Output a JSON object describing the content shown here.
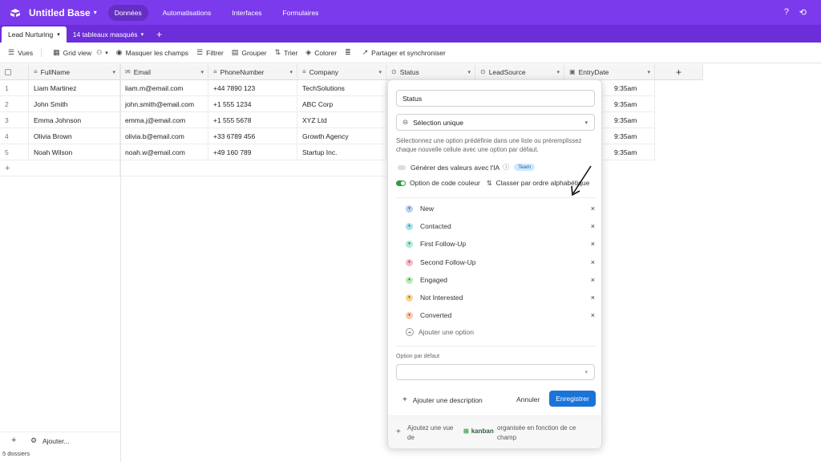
{
  "app": {
    "base_title": "Untitled Base",
    "nav": [
      "Données",
      "Automatisations",
      "Interfaces",
      "Formulaires"
    ],
    "active_nav": "Données",
    "colors": {
      "brand": "#7c3aed",
      "tabbar": "#6b2ed8",
      "primary": "#1a73d9"
    }
  },
  "tabs": {
    "active": "Lead Nurturing",
    "hidden": "14 tableaux masqués"
  },
  "toolbar": {
    "views": "Vues",
    "grid_view": "Grid view",
    "hide_fields": "Masquer les champs",
    "filter": "Filtrer",
    "group": "Grouper",
    "sort": "Trier",
    "color": "Colorer",
    "share": "Partager et synchroniser"
  },
  "table": {
    "headers": [
      "FullName",
      "Email",
      "PhoneNumber",
      "Company",
      "Status",
      "LeadSource",
      "EntryDate"
    ],
    "rows": [
      {
        "n": "1",
        "name": "Liam Martinez",
        "email": "liam.m@email.com",
        "phone": "+44 7890 123",
        "company": "TechSolutions",
        "time": "9:35am"
      },
      {
        "n": "2",
        "name": "John Smith",
        "email": "john.smith@email.com",
        "phone": "+1 555 1234",
        "company": "ABC Corp",
        "time": "9:35am"
      },
      {
        "n": "3",
        "name": "Emma Johnson",
        "email": "emma.j@email.com",
        "phone": "+1 555 5678",
        "company": "XYZ Ltd",
        "time": "9:35am"
      },
      {
        "n": "4",
        "name": "Olivia Brown",
        "email": "olivia.b@email.com",
        "phone": "+33 6789 456",
        "company": "Growth Agency",
        "time": "9:35am"
      },
      {
        "n": "5",
        "name": "Noah Wilson",
        "email": "noah.w@email.com",
        "phone": "+49 160 789",
        "company": "Startup Inc.",
        "time": "9:35am"
      }
    ],
    "add_row": "+"
  },
  "footer": {
    "add_label": "Ajouter...",
    "count": "5 dossiers"
  },
  "modal": {
    "field_name": "Status",
    "field_type": "Sélection unique",
    "description": "Sélectionnez une option prédéfinie dans une liste ou préremplissez chaque nouvelle cellule avec une option par défaut.",
    "ai_label": "Générer des valeurs avec l'IA",
    "ai_badge": "Team",
    "color_code": "Option de code couleur",
    "sort_alpha": "Classer par ordre alphabétique",
    "options": [
      {
        "label": "New",
        "color": "#b9cdf5"
      },
      {
        "label": "Contacted",
        "color": "#a8e0f0"
      },
      {
        "label": "First Follow-Up",
        "color": "#a6ecd9"
      },
      {
        "label": "Second Follow-Up",
        "color": "#f8b8c4"
      },
      {
        "label": "Engaged",
        "color": "#b9ecb3"
      },
      {
        "label": "Not Interested",
        "color": "#fbd38a"
      },
      {
        "label": "Converted",
        "color": "#f9c6a8"
      }
    ],
    "add_option": "Ajouter une option",
    "default_label": "Option par défaut",
    "add_description": "Ajouter une description",
    "cancel": "Annuler",
    "save": "Enregistrer",
    "footer_text1": "Ajoutez une vue de",
    "footer_kanban": "kanban",
    "footer_text2": "organisée en fonction de ce champ"
  }
}
